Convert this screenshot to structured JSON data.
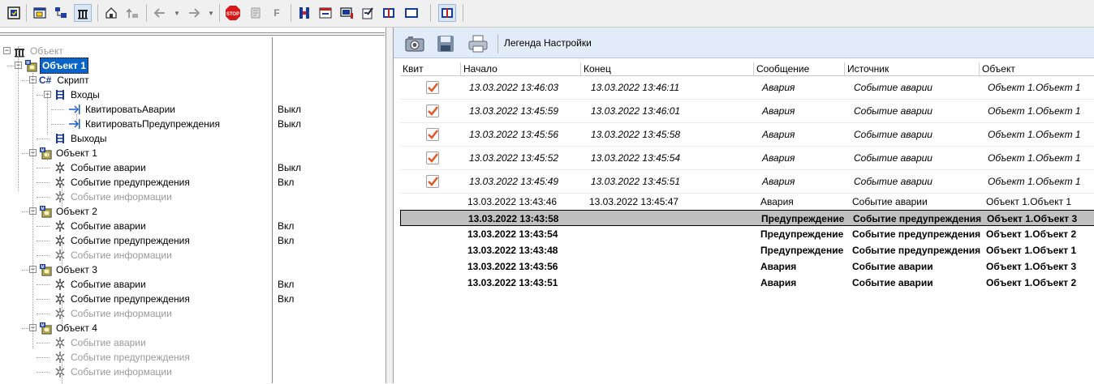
{
  "toolbar": {
    "buttons": [
      "object-properties-icon",
      "window-icon",
      "tree-view-icon",
      "list-view-icon",
      "home-icon",
      "up-folder-icon",
      "back-icon",
      "forward-icon",
      "stop-icon",
      "print-preview-icon",
      "filter-f-icon",
      "bookmarks-icon",
      "form-icon",
      "monitor-icon",
      "document-edit-icon",
      "book-icon",
      "blank-window-icon",
      "journal-icon"
    ],
    "stop_label": "STOP",
    "f_label": "F"
  },
  "tree": {
    "root": "Объект",
    "nodes": [
      {
        "label": "Объект 1",
        "value": "",
        "kind": "object-sel"
      },
      {
        "label": "Скрипт",
        "value": "",
        "kind": "script",
        "prefix": "C#"
      },
      {
        "label": "Входы",
        "value": "",
        "kind": "io"
      },
      {
        "label": "КвитироватьАварии",
        "value": "Выкл",
        "kind": "input"
      },
      {
        "label": "КвитироватьПредупреждения",
        "value": "Выкл",
        "kind": "input"
      },
      {
        "label": "Выходы",
        "value": "",
        "kind": "io"
      },
      {
        "label": "Объект 1",
        "value": "",
        "kind": "object"
      },
      {
        "label": "Событие аварии",
        "value": "Выкл",
        "kind": "event"
      },
      {
        "label": "Событие предупреждения",
        "value": "Вкл",
        "kind": "event"
      },
      {
        "label": "Событие информации",
        "value": "",
        "kind": "event-disabled"
      },
      {
        "label": "Объект 2",
        "value": "",
        "kind": "object"
      },
      {
        "label": "Событие аварии",
        "value": "Вкл",
        "kind": "event"
      },
      {
        "label": "Событие предупреждения",
        "value": "Вкл",
        "kind": "event"
      },
      {
        "label": "Событие информации",
        "value": "",
        "kind": "event-disabled"
      },
      {
        "label": "Объект 3",
        "value": "",
        "kind": "object"
      },
      {
        "label": "Событие аварии",
        "value": "Вкл",
        "kind": "event"
      },
      {
        "label": "Событие предупреждения",
        "value": "Вкл",
        "kind": "event"
      },
      {
        "label": "Событие информации",
        "value": "",
        "kind": "event-disabled"
      },
      {
        "label": "Объект 4",
        "value": "",
        "kind": "object"
      },
      {
        "label": "Событие аварии",
        "value": "",
        "kind": "event-disabled"
      },
      {
        "label": "Событие предупреждения",
        "value": "",
        "kind": "event-disabled"
      },
      {
        "label": "Событие информации",
        "value": "",
        "kind": "event-disabled"
      }
    ]
  },
  "events_panel": {
    "legend_label": "Легенда",
    "settings_label": "Настройки",
    "columns": [
      "Квит",
      "Начало",
      "Конец",
      "Сообщение",
      "Источник",
      "Объект"
    ],
    "rows": [
      {
        "ack": true,
        "start": "13.03.2022 13:46:03",
        "end": "13.03.2022 13:46:11",
        "message": "Авария",
        "source": "Событие аварии",
        "object": "Объект 1.Объект 1",
        "style": "italic"
      },
      {
        "ack": true,
        "start": "13.03.2022 13:45:59",
        "end": "13.03.2022 13:46:01",
        "message": "Авария",
        "source": "Событие аварии",
        "object": "Объект 1.Объект 1",
        "style": "italic"
      },
      {
        "ack": true,
        "start": "13.03.2022 13:45:56",
        "end": "13.03.2022 13:45:58",
        "message": "Авария",
        "source": "Событие аварии",
        "object": "Объект 1.Объект 1",
        "style": "italic"
      },
      {
        "ack": true,
        "start": "13.03.2022 13:45:52",
        "end": "13.03.2022 13:45:54",
        "message": "Авария",
        "source": "Событие аварии",
        "object": "Объект 1.Объект 1",
        "style": "italic"
      },
      {
        "ack": true,
        "start": "13.03.2022 13:45:49",
        "end": "13.03.2022 13:45:51",
        "message": "Авария",
        "source": "Событие аварии",
        "object": "Объект 1.Объект 1",
        "style": "italic"
      },
      {
        "ack": false,
        "start": "13.03.2022 13:43:46",
        "end": "13.03.2022 13:45:47",
        "message": "Авария",
        "source": "Событие аварии",
        "object": "Объект 1.Объект 1",
        "style": "normal"
      },
      {
        "ack": false,
        "start": "13.03.2022 13:43:58",
        "end": "",
        "message": "Предупреждение",
        "source": "Событие предупреждения",
        "object": "Объект 1.Объект 3",
        "style": "bold",
        "selected": true
      },
      {
        "ack": false,
        "start": "13.03.2022 13:43:54",
        "end": "",
        "message": "Предупреждение",
        "source": "Событие предупреждения",
        "object": "Объект 1.Объект 2",
        "style": "bold"
      },
      {
        "ack": false,
        "start": "13.03.2022 13:43:48",
        "end": "",
        "message": "Предупреждение",
        "source": "Событие предупреждения",
        "object": "Объект 1.Объект 1",
        "style": "bold"
      },
      {
        "ack": false,
        "start": "13.03.2022 13:43:56",
        "end": "",
        "message": "Авария",
        "source": "Событие аварии",
        "object": "Объект 1.Объект 3",
        "style": "bold"
      },
      {
        "ack": false,
        "start": "13.03.2022 13:43:51",
        "end": "",
        "message": "Авария",
        "source": "Событие аварии",
        "object": "Объект 1.Объект 2",
        "style": "bold"
      }
    ]
  },
  "colors": {
    "selection": "#0a64c8",
    "toolbar_bg": "#f0f0f0",
    "event_toolbar_bg": "#e2ecf8",
    "check": "#e05a28"
  }
}
